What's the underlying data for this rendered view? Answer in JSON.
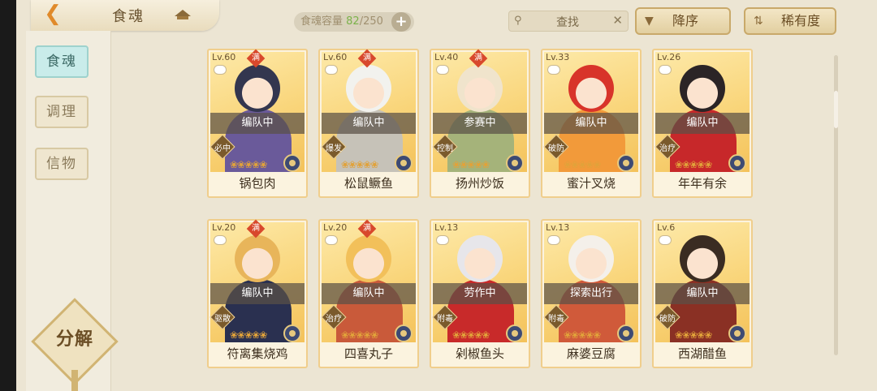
{
  "header": {
    "title": "食魂",
    "capacity_label": "食魂容量",
    "capacity_current": "82",
    "capacity_sep_total": "/250",
    "search_placeholder": "查找",
    "sort_order_label": "降序",
    "sort_by_label": "稀有度"
  },
  "sidebar": {
    "tabs": [
      {
        "label": "食魂",
        "active": true
      },
      {
        "label": "调理",
        "active": false
      },
      {
        "label": "信物",
        "active": false
      }
    ],
    "decompose_label": "分解"
  },
  "cards": [
    {
      "level": "Lv.60",
      "maxed": true,
      "man": "满",
      "status": "编队中",
      "role": "必中",
      "name": "锅包肉",
      "colors": [
        "#33364f",
        "#6a5a9a"
      ]
    },
    {
      "level": "Lv.60",
      "maxed": true,
      "man": "满",
      "status": "编队中",
      "role": "爆发",
      "name": "松鼠鳜鱼",
      "colors": [
        "#f2f2ee",
        "#c6c2b8"
      ]
    },
    {
      "level": "Lv.40",
      "maxed": true,
      "man": "满",
      "status": "参赛中",
      "role": "控制",
      "name": "扬州炒饭",
      "colors": [
        "#f0e4cc",
        "#a5b37a"
      ]
    },
    {
      "level": "Lv.33",
      "maxed": false,
      "man": "",
      "status": "编队中",
      "role": "破防",
      "name": "蜜汁叉烧",
      "colors": [
        "#d8342a",
        "#f29a3a"
      ]
    },
    {
      "level": "Lv.26",
      "maxed": false,
      "man": "",
      "status": "编队中",
      "role": "治疗",
      "name": "年年有余",
      "colors": [
        "#2b2426",
        "#c7282a"
      ]
    },
    {
      "level": "Lv.20",
      "maxed": true,
      "man": "满",
      "status": "编队中",
      "role": "驱散",
      "name": "符离集烧鸡",
      "colors": [
        "#e8b55a",
        "#2a3050"
      ]
    },
    {
      "level": "Lv.20",
      "maxed": true,
      "man": "满",
      "status": "编队中",
      "role": "治疗",
      "name": "四喜丸子",
      "colors": [
        "#f2c05a",
        "#c95a3a"
      ]
    },
    {
      "level": "Lv.13",
      "maxed": false,
      "man": "",
      "status": "劳作中",
      "role": "附毒",
      "name": "剁椒鱼头",
      "colors": [
        "#e7e6ea",
        "#c82a2a"
      ]
    },
    {
      "level": "Lv.13",
      "maxed": false,
      "man": "",
      "status": "探索出行",
      "role": "附毒",
      "name": "麻婆豆腐",
      "colors": [
        "#f4f0ea",
        "#d05a3a"
      ]
    },
    {
      "level": "Lv.6",
      "maxed": false,
      "man": "",
      "status": "编队中",
      "role": "破防",
      "name": "西湖醋鱼",
      "colors": [
        "#3a2c22",
        "#8a3024"
      ]
    }
  ]
}
